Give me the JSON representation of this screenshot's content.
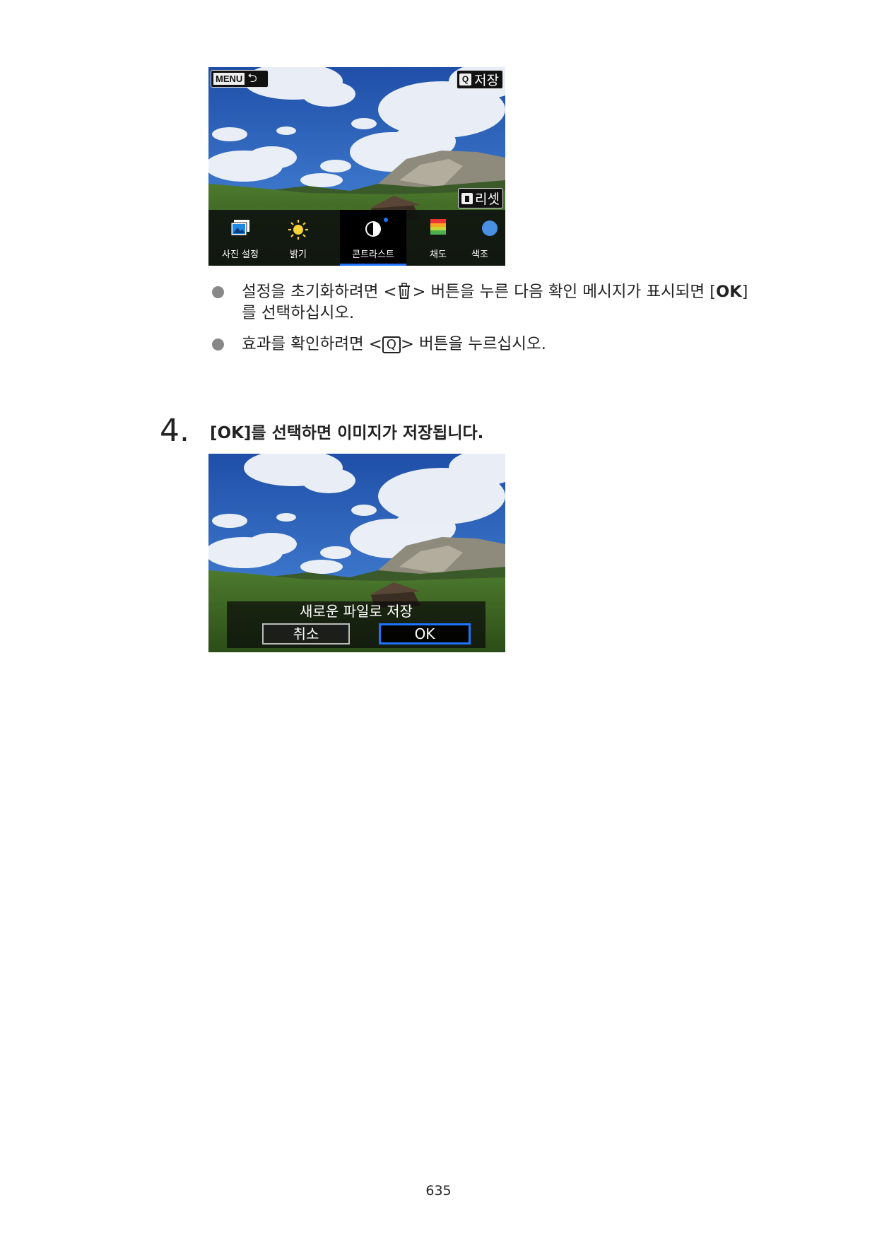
{
  "screen1": {
    "menu_button": "MENU",
    "save_button": "저장",
    "q_key": "Q",
    "reset_button": "리셋",
    "menu_items": [
      {
        "label": "사진 설정",
        "icon": "picture-style-icon"
      },
      {
        "label": "밝기",
        "icon": "brightness-sun-icon"
      },
      {
        "label": "콘트라스트",
        "icon": "contrast-icon",
        "selected": true
      },
      {
        "label": "채도",
        "icon": "saturation-icon"
      },
      {
        "label": "색조",
        "icon": "color-tone-icon"
      }
    ]
  },
  "bullets": [
    {
      "before": "설정을 초기화하려면 <",
      "after": "> 버튼을 누른 다음 확인 메시지가 표시되면 [",
      "bold": "OK",
      "end": "]",
      "line2": "를 선택하십시오."
    },
    {
      "before": "효과를 확인하려면 <",
      "key": "Q",
      "after": "> 버튼을 누르십시오."
    }
  ],
  "step": {
    "number": "4.",
    "text": "[OK]를 선택하면 이미지가 저장됩니다."
  },
  "screen2": {
    "dialog_title": "새로운 파일로 저장",
    "cancel_button": "취소",
    "ok_button": "OK"
  },
  "page_number": "635",
  "colors": {
    "accent_blue": "#1e74ff",
    "bullet_gray": "#888888"
  }
}
